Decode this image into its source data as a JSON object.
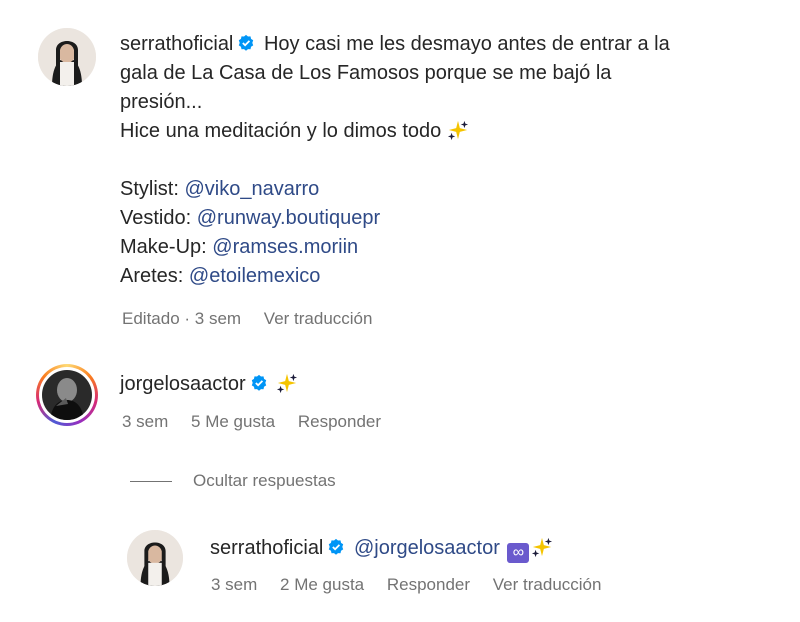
{
  "post": {
    "username": "serrathoficial",
    "caption_line1": "Hoy casi me les desmayo antes de entrar a la",
    "caption_line2": "gala de La Casa de Los Famosos porque se me bajó la",
    "caption_line3": "presión...",
    "caption_line4": "Hice una meditación y lo dimos todo",
    "credits": [
      {
        "label": "Stylist:",
        "mention": "@viko_navarro"
      },
      {
        "label": "Vestido:",
        "mention": "@runway.boutiquepr"
      },
      {
        "label": "Make-Up:",
        "mention": "@ramses.moriin"
      },
      {
        "label": "Aretes:",
        "mention": "@etoilemexico"
      }
    ],
    "meta": {
      "edited_time": "Editado · 3 sem",
      "translate": "Ver traducción"
    }
  },
  "comment": {
    "username": "jorgelosaactor",
    "meta": {
      "time": "3 sem",
      "likes": "5 Me gusta",
      "reply": "Responder"
    }
  },
  "replies_toggle": "Ocultar respuestas",
  "reply": {
    "username": "serrathoficial",
    "mention": "@jorgelosaactor",
    "infinity_icon": "∞",
    "meta": {
      "time": "3 sem",
      "likes": "2 Me gusta",
      "reply": "Responder",
      "translate": "Ver traducción"
    }
  },
  "colors": {
    "verified": "#0095f6",
    "mention": "#2f4a87",
    "meta": "#737373"
  }
}
